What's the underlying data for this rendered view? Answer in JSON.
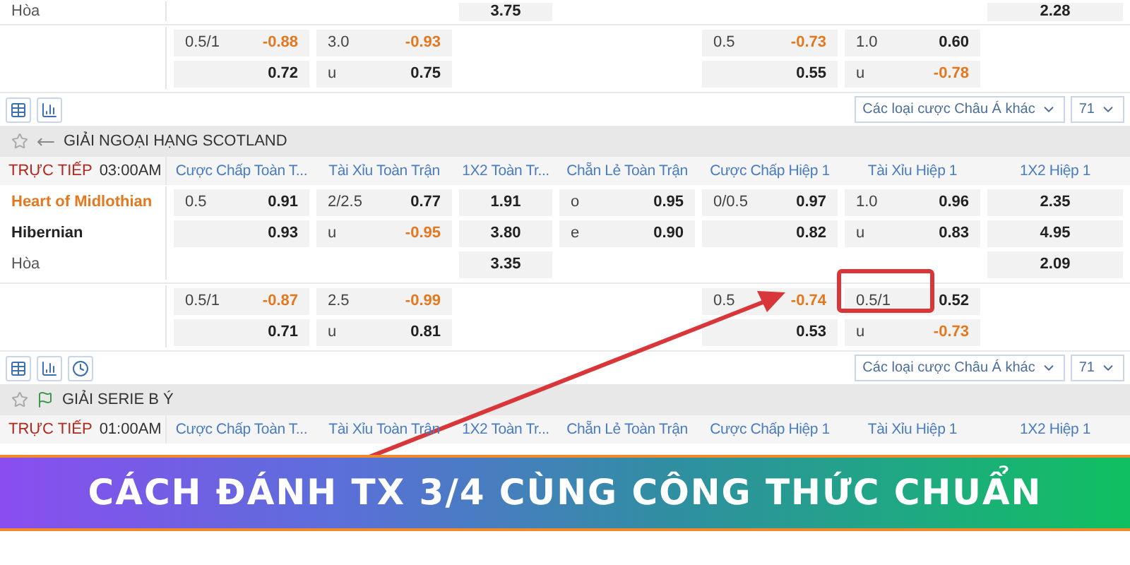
{
  "previous_match": {
    "rows": [
      {
        "label": "Hòa",
        "kind": "draw",
        "cells": [
          null,
          null,
          {
            "odds": "3.75"
          },
          null,
          null,
          null,
          {
            "odds": "2.28"
          }
        ]
      }
    ],
    "extra_rows": [
      {
        "cells": [
          {
            "line": "0.5/1",
            "odds": "-0.88",
            "negative": true
          },
          {
            "line": "3.0",
            "odds": "-0.93",
            "negative": true
          },
          null,
          null,
          {
            "line": "0.5",
            "odds": "-0.73",
            "negative": true
          },
          {
            "line": "1.0",
            "odds": "0.60",
            "negative": false
          },
          null
        ]
      },
      {
        "cells": [
          {
            "odds": "0.72",
            "negative": false
          },
          {
            "line": "u",
            "odds": "0.75",
            "negative": false
          },
          null,
          null,
          {
            "odds": "0.55",
            "negative": false
          },
          {
            "line": "u",
            "odds": "-0.78",
            "negative": true
          },
          null
        ]
      }
    ]
  },
  "leagues": [
    {
      "toolbar": {
        "tools": [
          {
            "kind": "table"
          },
          {
            "kind": "chart"
          }
        ],
        "filter": "Các loại cược Châu Á khác",
        "count": "71"
      },
      "name": "GIẢI NGOẠI HẠNG SCOTLAND",
      "status": "TRỰC TIẾP",
      "time": "03:00AM",
      "columns": [
        "Cược Chấp Toàn T...",
        "Tài Xỉu Toàn Trận",
        "1X2 Toàn Tr...",
        "Chẵn Lẻ Toàn Trận",
        "Cược Chấp Hiệp 1",
        "Tài Xỉu Hiệp 1",
        "1X2 Hiệp 1"
      ],
      "rows": [
        {
          "label": "Heart of Midlothian",
          "kind": "favorite",
          "cells": [
            {
              "line": "0.5",
              "odds": "0.91",
              "negative": false
            },
            {
              "line": "2/2.5",
              "odds": "0.77",
              "negative": false
            },
            {
              "odds": "1.91",
              "negative": false
            },
            {
              "line": "o",
              "odds": "0.95",
              "negative": false
            },
            {
              "line": "0/0.5",
              "odds": "0.97",
              "negative": false
            },
            {
              "line": "1.0",
              "odds": "0.96",
              "negative": false
            },
            {
              "odds": "2.35",
              "negative": false
            }
          ]
        },
        {
          "label": "Hibernian",
          "kind": "team",
          "cells": [
            {
              "odds": "0.93",
              "negative": false
            },
            {
              "line": "u",
              "odds": "-0.95",
              "negative": true
            },
            {
              "odds": "3.80",
              "negative": false
            },
            {
              "line": "e",
              "odds": "0.90",
              "negative": false
            },
            {
              "odds": "0.82",
              "negative": false
            },
            {
              "line": "u",
              "odds": "0.83",
              "negative": false
            },
            {
              "odds": "4.95",
              "negative": false
            }
          ]
        },
        {
          "label": "Hòa",
          "kind": "draw",
          "cells": [
            null,
            null,
            {
              "odds": "3.35",
              "negative": false
            },
            null,
            null,
            null,
            {
              "odds": "2.09",
              "negative": false
            }
          ]
        }
      ],
      "extra_rows": [
        {
          "cells": [
            {
              "line": "0.5/1",
              "odds": "-0.87",
              "negative": true
            },
            {
              "line": "2.5",
              "odds": "-0.99",
              "negative": true
            },
            null,
            null,
            {
              "line": "0.5",
              "odds": "-0.74",
              "negative": true
            },
            {
              "line": "0.5/1",
              "odds": "0.52",
              "negative": false
            },
            null
          ]
        },
        {
          "cells": [
            {
              "odds": "0.71",
              "negative": false
            },
            {
              "line": "u",
              "odds": "0.81",
              "negative": false
            },
            null,
            null,
            {
              "odds": "0.53",
              "negative": false
            },
            {
              "line": "u",
              "odds": "-0.73",
              "negative": true
            },
            null
          ]
        }
      ]
    },
    {
      "toolbar": {
        "tools": [
          {
            "kind": "table"
          },
          {
            "kind": "chart"
          },
          {
            "kind": "clock"
          }
        ],
        "filter": "Các loại cược Châu Á khác",
        "count": "71"
      },
      "name": "GIẢI SERIE B Ý",
      "status": "TRỰC TIẾP",
      "time": "01:00AM",
      "columns": [
        "Cược Chấp Toàn T...",
        "Tài Xỉu Toàn Trận",
        "1X2 Toàn Tr...",
        "Chẵn Lẻ Toàn Trận",
        "Cược Chấp Hiệp 1",
        "Tài Xỉu Hiệp 1",
        "1X2 Hiệp 1"
      ]
    }
  ],
  "banner": {
    "title": "CÁCH ĐÁNH TX 3/4 CÙNG CÔNG THỨC CHUẨN"
  }
}
